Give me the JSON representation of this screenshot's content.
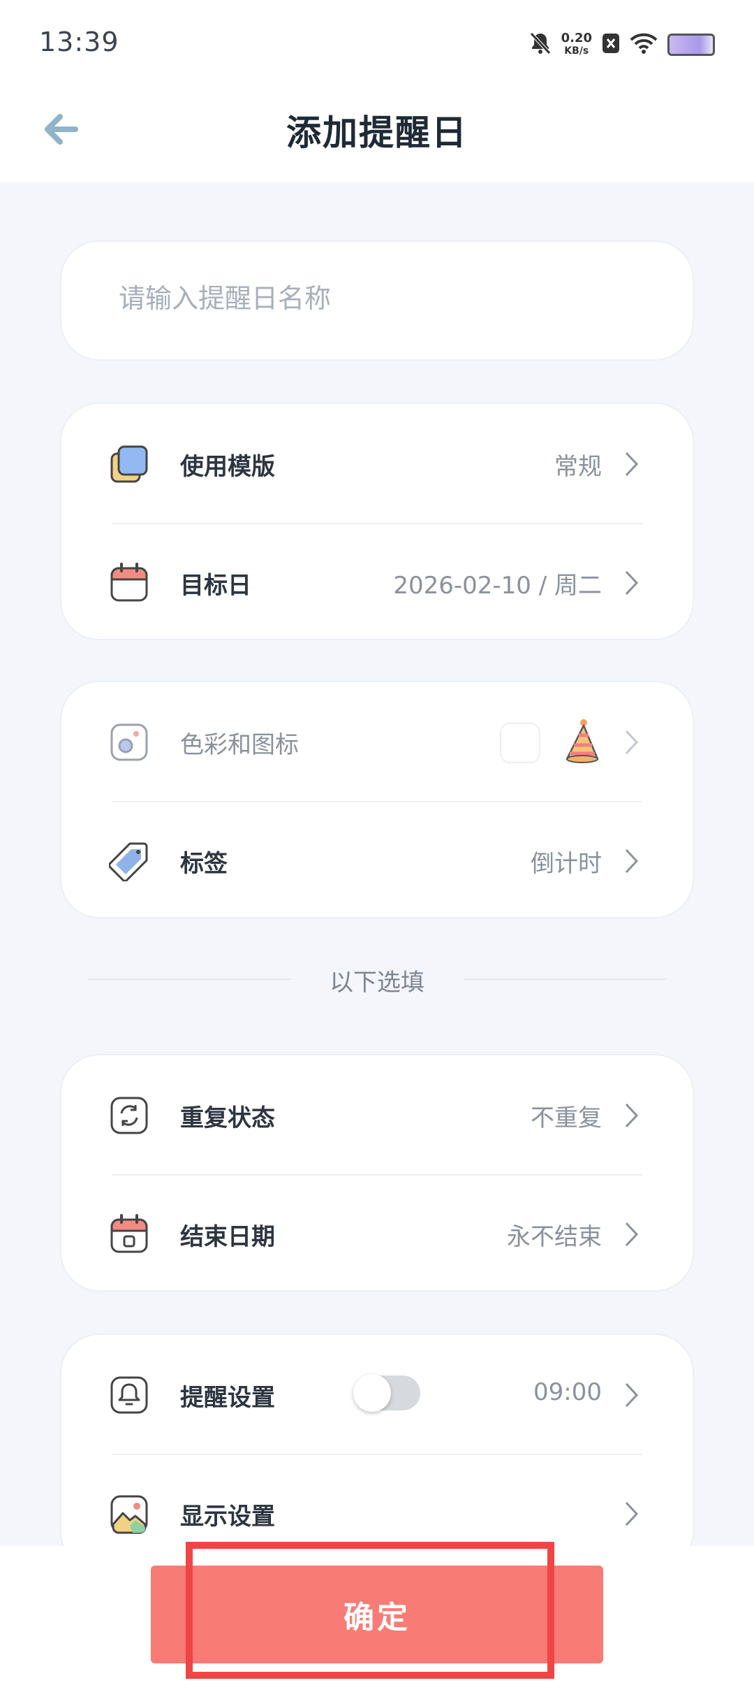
{
  "status_bar": {
    "time": "13:39",
    "net_speed_value": "0.20",
    "net_speed_unit": "KB/s"
  },
  "header": {
    "title": "添加提醒日"
  },
  "name_input": {
    "placeholder": "请输入提醒日名称",
    "value": ""
  },
  "basic": {
    "template_label": "使用模版",
    "template_value": "常规",
    "target_label": "目标日",
    "target_value": "2026-02-10 / 周二"
  },
  "style": {
    "color_icon_label": "色彩和图标",
    "tag_label": "标签",
    "tag_value": "倒计时"
  },
  "optional_divider": "以下选填",
  "repeat": {
    "repeat_label": "重复状态",
    "repeat_value": "不重复",
    "end_label": "结束日期",
    "end_value": "永不结束"
  },
  "reminder": {
    "reminder_label": "提醒设置",
    "reminder_time": "09:00",
    "reminder_enabled": false,
    "display_label": "显示设置"
  },
  "footer": {
    "confirm_label": "确定"
  },
  "colors": {
    "accent": "#f87b75",
    "highlight": "#ef4544",
    "background": "#f4f6fb"
  }
}
